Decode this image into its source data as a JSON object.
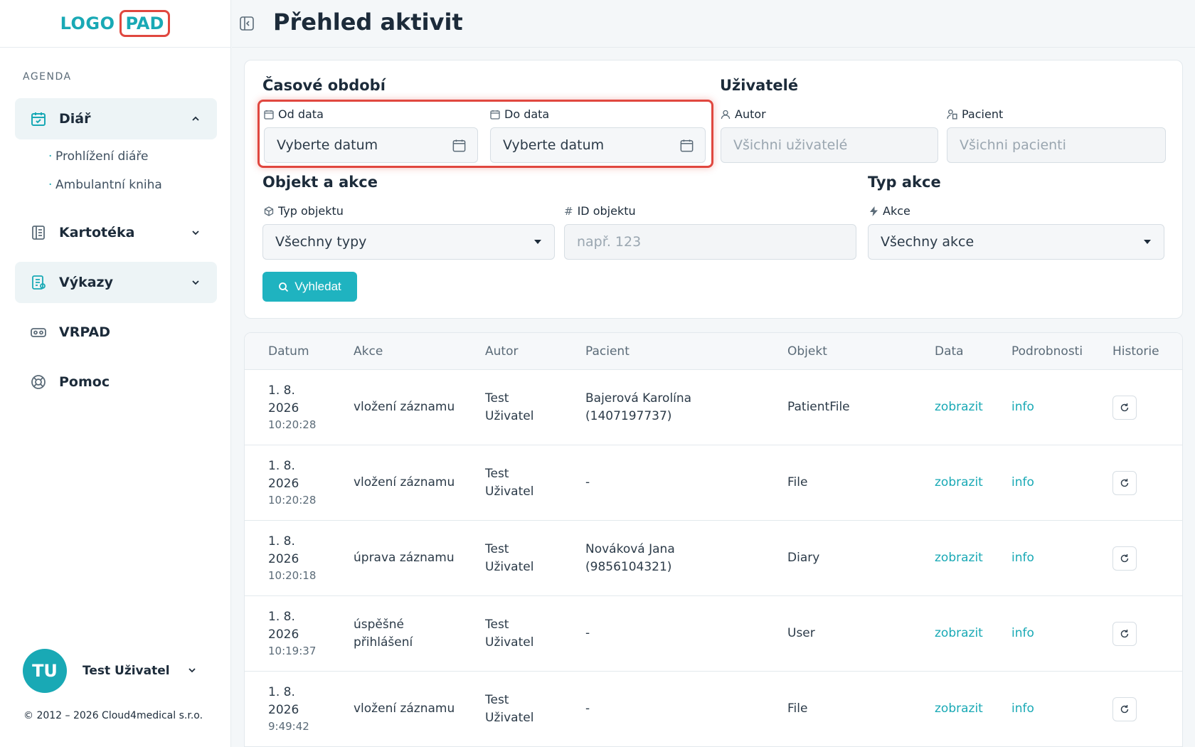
{
  "logo": {
    "left": "LOGO",
    "right": "PAD"
  },
  "sidebar": {
    "section_label": "AGENDA",
    "items": [
      {
        "label": "Diář",
        "icon": "calendar-check-icon"
      },
      {
        "label": "Kartotéka",
        "icon": "cabinet-icon"
      },
      {
        "label": "Výkazy",
        "icon": "report-icon"
      },
      {
        "label": "VRPAD",
        "icon": "vr-headset-icon"
      },
      {
        "label": "Pomoc",
        "icon": "lifebuoy-icon"
      }
    ],
    "sub_items": [
      "Prohlížení diáře",
      "Ambulantní kniha"
    ],
    "user": {
      "initials": "TU",
      "name": "Test Uživatel"
    },
    "copyright": "© 2012 – 2026 Cloud4medical s.r.o."
  },
  "header": {
    "title": "Přehled aktivit"
  },
  "filters": {
    "period": {
      "title": "Časové období",
      "from_label": "Od data",
      "from_value": "Vyberte datum",
      "to_label": "Do data",
      "to_value": "Vyberte datum"
    },
    "users": {
      "title": "Uživatelé",
      "author_label": "Autor",
      "author_placeholder": "Všichni uživatelé",
      "patient_label": "Pacient",
      "patient_placeholder": "Všichni pacienti"
    },
    "object": {
      "title": "Objekt a akce",
      "type_label": "Typ objektu",
      "type_value": "Všechny typy",
      "id_label": "ID objektu",
      "id_placeholder": "např. 123"
    },
    "action": {
      "title": "Typ akce",
      "action_label": "Akce",
      "action_value": "Všechny akce"
    },
    "search_label": "Vyhledat"
  },
  "table": {
    "columns": [
      "Datum",
      "Akce",
      "Autor",
      "Pacient",
      "Objekt",
      "Data",
      "Podrobnosti",
      "Historie"
    ],
    "rows": [
      {
        "date1": "1. 8.",
        "date2": "2026",
        "time": "10:20:28",
        "action": "vložení záznamu",
        "author1": "Test",
        "author2": "Uživatel",
        "patient1": "Bajerová Karolína",
        "patient2": "(1407197737)",
        "object": "PatientFile",
        "data": "zobrazit",
        "details": "info"
      },
      {
        "date1": "1. 8.",
        "date2": "2026",
        "time": "10:20:28",
        "action": "vložení záznamu",
        "author1": "Test",
        "author2": "Uživatel",
        "patient1": "-",
        "patient2": "",
        "object": "File",
        "data": "zobrazit",
        "details": "info"
      },
      {
        "date1": "1. 8.",
        "date2": "2026",
        "time": "10:20:18",
        "action": "úprava záznamu",
        "author1": "Test",
        "author2": "Uživatel",
        "patient1": "Nováková Jana",
        "patient2": "(9856104321)",
        "object": "Diary",
        "data": "zobrazit",
        "details": "info"
      },
      {
        "date1": "1. 8.",
        "date2": "2026",
        "time": "10:19:37",
        "action": "úspěšné přihlášení",
        "author1": "Test",
        "author2": "Uživatel",
        "patient1": "-",
        "patient2": "",
        "object": "User",
        "data": "zobrazit",
        "details": "info"
      },
      {
        "date1": "1. 8.",
        "date2": "2026",
        "time": "9:49:42",
        "action": "vložení záznamu",
        "author1": "Test",
        "author2": "Uživatel",
        "patient1": "-",
        "patient2": "",
        "object": "File",
        "data": "zobrazit",
        "details": "info"
      }
    ]
  },
  "colors": {
    "accent": "#19a9b5",
    "highlight": "#e0473f",
    "button": "#1fb3c0"
  }
}
